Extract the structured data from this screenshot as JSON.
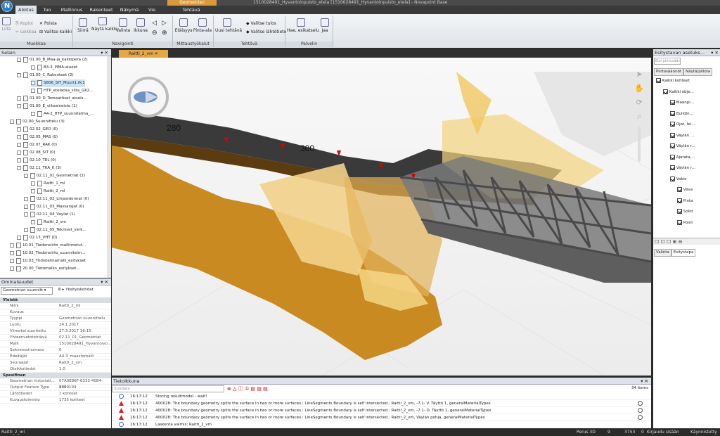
{
  "window": {
    "title": "1510028491_Hyvantoinpuisto_etela [1510028491_Hyvantoinpuisto_etela] - Novapoint Base",
    "context_tab": "Geometrian suunnittelu",
    "logo": "N"
  },
  "ribbon_tabs": [
    "Aloitus",
    "Tuo",
    "Mallinnus",
    "Rakenteet",
    "Näkymä",
    "Vie",
    "Tehtävä"
  ],
  "ribbon": {
    "muokkaa": {
      "label": "Muokkaa",
      "liita": "Liitä",
      "kopioi": "Kopioi",
      "leikkaa": "Leikkaa",
      "poista": "Poista",
      "valitse_kaikki": "Valitse kaikki"
    },
    "navigointi": {
      "label": "Navigointi",
      "siirra": "Siirrä",
      "nayta_kaikki": "Näytä kaikki",
      "valinta": "Valinta",
      "ikkuna": "Ikkuna"
    },
    "mittaus": {
      "label": "Mittaustyökalut",
      "etaisyys": "Etäisyys",
      "pinta_ala": "Pinta-ala"
    },
    "tehtava": {
      "label": "Tehtävä",
      "uusi": "Uusi tehtävä",
      "valitse_tulos": "Valitse tulos",
      "valitse_lahtotieto": "Valitse lähtötieto"
    },
    "palvelin": {
      "label": "Palvelin",
      "hae": "Hae, esikatselu",
      "jaa": "Jaa"
    }
  },
  "browser": {
    "title": "Selain",
    "items": [
      {
        "label": "01.00_B_Maa-ja_kalliopera",
        "count": "(2)",
        "indent": 2
      },
      {
        "label": "B3-3_PIMA-alueet",
        "count": "",
        "indent": 4
      },
      {
        "label": "01.00_C_Rakenteet",
        "count": "(2)",
        "indent": 2
      },
      {
        "label": "S806_SIT_Muuri1.ifc1",
        "count": "",
        "indent": 4
      },
      {
        "label": "HTP_etelaosa_silta_GK2...",
        "count": "",
        "indent": 4
      },
      {
        "label": "01.00_D_Temaattiset_aineis...",
        "count": "",
        "indent": 2
      },
      {
        "label": "01.00_E_viiteaineisto",
        "count": "(1)",
        "indent": 2
      },
      {
        "label": "A4-2_HTP_suunnitelma_...",
        "count": "",
        "indent": 4
      },
      {
        "label": "02.00_Suunnittelu",
        "count": "(3)",
        "indent": 1
      },
      {
        "label": "02.02_GEO",
        "count": "(0)",
        "indent": 2
      },
      {
        "label": "02.05_MAS",
        "count": "(0)",
        "indent": 2
      },
      {
        "label": "02.07_RAK",
        "count": "(0)",
        "indent": 2
      },
      {
        "label": "02.08_SIT",
        "count": "(0)",
        "indent": 2
      },
      {
        "label": "02.10_TEL",
        "count": "(0)",
        "indent": 2
      },
      {
        "label": "02.11_TKA_K",
        "count": "(3)",
        "indent": 2
      },
      {
        "label": "02.11_01_Geometriat",
        "count": "(2)",
        "indent": 3
      },
      {
        "label": "Raitti_1_ml",
        "count": "",
        "indent": 4
      },
      {
        "label": "Raitti_2_ml",
        "count": "",
        "indent": 4
      },
      {
        "label": "02.11_02_Linjasidonnat",
        "count": "(0)",
        "indent": 3
      },
      {
        "label": "02.11_03_Massarajat",
        "count": "(0)",
        "indent": 3
      },
      {
        "label": "02.11_04_Vaylat",
        "count": "(1)",
        "indent": 3
      },
      {
        "label": "Raitti_2_vm",
        "count": "",
        "indent": 4
      },
      {
        "label": "02.11_05_Tekniset_verk...",
        "count": "",
        "indent": 3
      },
      {
        "label": "02.13_VHT",
        "count": "(0)",
        "indent": 2
      },
      {
        "label": "10.01_Tiedonsiirto_mallinnetut...",
        "count": "",
        "indent": 1
      },
      {
        "label": "10.02_Tiedonsiirto_suunnitelm...",
        "count": "",
        "indent": 1
      },
      {
        "label": "10.03_Yhdistelmamalli_esitykset",
        "count": "",
        "indent": 1
      },
      {
        "label": "20.00_Tietomallin_esitykset...",
        "count": "",
        "indent": 1
      }
    ]
  },
  "properties": {
    "title": "Ominaisuudet",
    "selector": "Geometrian suunnitt",
    "details_btn": "Yksityiskohdat",
    "cat1": "Yleistä",
    "cat2": "Spesifinen",
    "rows": [
      [
        "Nimi",
        "Raitti_2_ml"
      ],
      [
        "Kuvaus",
        ""
      ],
      [
        "Tyyppi",
        "Geometrian suunnittelu"
      ],
      [
        "Luotu",
        "24.1.2017"
      ],
      [
        "Viimeksi suoritettu",
        "27.3.2017 16:15"
      ],
      [
        "Yhteenvetotehtävä",
        "02.11_01_Geometriat"
      ],
      [
        "Malli",
        "1510028491_Hyvantoivo..."
      ],
      [
        "Sekvenssinumero",
        "0"
      ],
      [
        "Edeltäjät",
        "A4-3_maastomalli"
      ],
      [
        "Seuraajat",
        "Raitti_2_vm"
      ],
      [
        "Otsikkotiedot",
        "1.0"
      ]
    ],
    "rows2": [
      [
        "Geometrian historiati...",
        "07A0E86F-6333-4084-831..."
      ],
      [
        "Output Feature Type",
        "1000194"
      ],
      [
        "Lähtötiedot",
        "1 kohteet"
      ],
      [
        "Kuvaustoiminto",
        "1735 kohteet"
      ]
    ]
  },
  "doc_tab": "Raitti_2_vm",
  "stations": [
    "280",
    "300"
  ],
  "log": {
    "title": "Tietoikkuna",
    "search_placeholder": "Suodata",
    "count": "34 items",
    "rows": [
      {
        "type": "info",
        "time": "16:17:12",
        "msg": "Storing resultmodel - wait!"
      },
      {
        "type": "warn",
        "time": "16:17:12",
        "msg": "400028: The boundary geometry splits the surface in two or more surfaces.: LineSegments Boundary is self intersected.: Raitti_2_vm, -7.1-  V. Täyttö 1, generalMaterialTypes"
      },
      {
        "type": "warn",
        "time": "16:17:12",
        "msg": "400028: The boundary geometry splits the surface in two or more surfaces.: LineSegments Boundary is self intersected.: Raitti_2_vm, -7.1-  O. Täyttö 1, generalMaterialTypes"
      },
      {
        "type": "warn",
        "time": "16:17:12",
        "msg": "400028: The boundary geometry splits the surface in two or more surfaces.: LineSegments Boundary is self intersected.: Raitti_2_vm, Väylän pohja, generalMaterialTypes"
      },
      {
        "type": "info",
        "time": "16:17:12",
        "msg": "Laskenta valmis: Raitti_2_vm"
      }
    ]
  },
  "right_panel": {
    "title": "Esitystavan asetuks...",
    "search_placeholder": "Etsi piirtosään",
    "tab1": "Piirtosäännöt",
    "tab2": "Näytä/piilota",
    "items": [
      {
        "label": "Kaikki kohteet",
        "indent": 0
      },
      {
        "label": "Kaikki obje...",
        "indent": 1
      },
      {
        "label": "Maanpi...",
        "indent": 2
      },
      {
        "label": "Buildin...",
        "indent": 2
      },
      {
        "label": "Ojat, lei...",
        "indent": 2
      },
      {
        "label": "Väylän ...",
        "indent": 2
      },
      {
        "label": "Väylän r...",
        "indent": 2
      },
      {
        "label": "Ajorata,...",
        "indent": 2
      },
      {
        "label": "Väylän r...",
        "indent": 2
      },
      {
        "label": "Vakio",
        "indent": 2
      },
      {
        "label": "Viiva",
        "indent": 3
      },
      {
        "label": "Pinta",
        "indent": 3
      },
      {
        "label": "Solid",
        "indent": 3
      },
      {
        "label": "Point",
        "indent": 3
      }
    ],
    "bottom_tab1": "Valinta",
    "bottom_tab2": "Esitystapa"
  },
  "status": {
    "left": "Raitti_2_ml",
    "view": "Perus 3D",
    "n1": "9",
    "n2": "3753",
    "n3": "0",
    "user": "Kirjaudu sisään",
    "mode": "Käynnistetty"
  }
}
